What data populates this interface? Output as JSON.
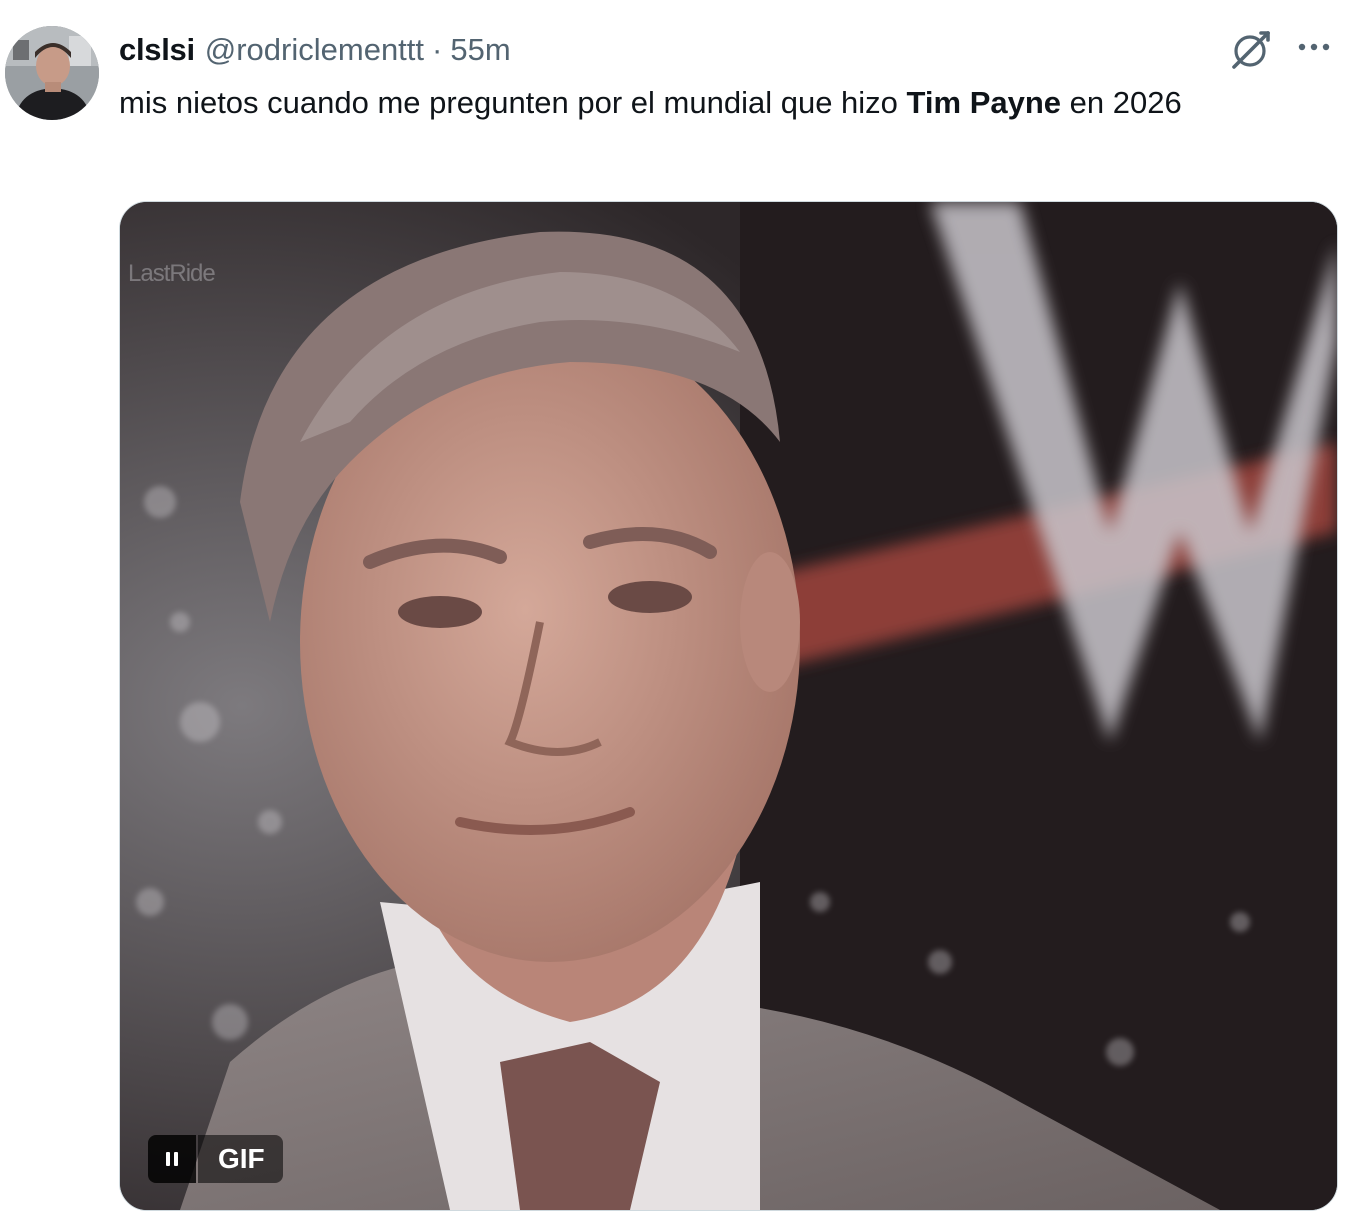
{
  "tweet": {
    "display_name": "clslsi",
    "handle": "@rodriclementtt",
    "separator": "·",
    "time": "55m",
    "text_before": "mis nietos cuando me pregunten por el mundial que hizo ",
    "text_bold": "Tim Payne",
    "text_after": " en 2026",
    "icons": {
      "grok": "grok-icon",
      "more": "more-options-icon"
    }
  },
  "media": {
    "type": "gif",
    "watermark": "LastRide",
    "gif_label": "GIF",
    "pause_icon": "pause-icon"
  },
  "colors": {
    "text_primary": "#0f1419",
    "text_secondary": "#536471",
    "border": "#cfd9de"
  }
}
